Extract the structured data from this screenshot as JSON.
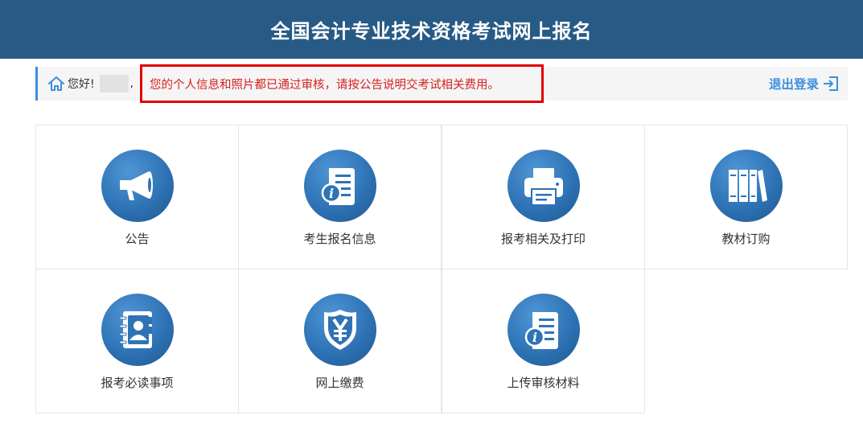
{
  "header": {
    "title": "全国会计专业技术资格考试网上报名"
  },
  "welcome": {
    "greeting": "您好!",
    "comma": ",",
    "notice": "您的个人信息和照片都已通过审核，请按公告说明交考试相关费用。",
    "logout_label": "退出登录"
  },
  "tiles": [
    {
      "label": "公告",
      "icon": "megaphone-icon"
    },
    {
      "label": "考生报名信息",
      "icon": "info-document-icon"
    },
    {
      "label": "报考相关及打印",
      "icon": "printer-icon"
    },
    {
      "label": "教材订购",
      "icon": "books-icon"
    },
    {
      "label": "报考必读事项",
      "icon": "contact-book-icon"
    },
    {
      "label": "网上缴费",
      "icon": "yuan-shield-icon"
    },
    {
      "label": "上传审核材料",
      "icon": "info-document-icon"
    }
  ],
  "colors": {
    "header_bg": "#285a86",
    "accent": "#3d8ede",
    "notice_red": "#d61e1e",
    "icon_blue": "#2e73b5"
  }
}
